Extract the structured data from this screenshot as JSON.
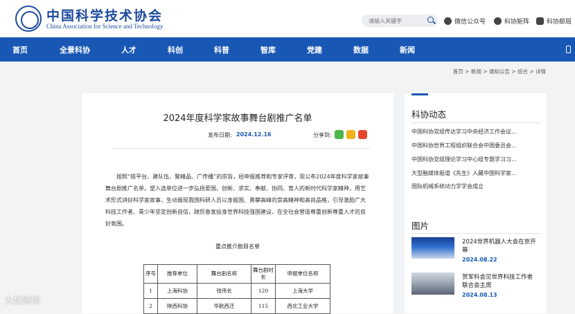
{
  "header": {
    "logo_cn": "中国科学技术协会",
    "logo_en": "China Association for Science and Technology",
    "search_placeholder": "请输入关键字",
    "links": [
      "微信公众号",
      "科协矩阵",
      "科协邮局"
    ]
  },
  "nav": {
    "items": [
      "首页",
      "全景科协",
      "人才",
      "科创",
      "科普",
      "智库",
      "党建",
      "数据",
      "新闻"
    ]
  },
  "breadcrumb": "首页 > 新闻 > 通知公告 > 综合 > 详情",
  "article": {
    "title": "2024年度科学家故事舞台剧推广名单",
    "date_label": "发布日期:",
    "date": "2024.12.16",
    "share_label": "分享到:",
    "body": "按照“搭平台、建队伍、聚精品、广传播”的宗旨，经申报推荐和专家评审，现公布2024年度科学家故事舞台剧推广名单。望入选单位进一步弘扬爱国、创新、求实、奉献、协同、育人的新时代科学家精神，用艺术形式讲好科学家故事，生动展现我国科研人员以身报国、勇攀高峰的崇高精神和高尚品格，引导激励广大科技工作者、青少年坚定创新自信，踔厉奋发投身世界科技强国建设，在全社会营造尊重创新尊重人才的良好氛围。",
    "subtitle": "重点推介剧目名单",
    "table": {
      "headers": [
        "序号",
        "推荐单位",
        "舞台剧名称",
        "舞台剧时长",
        "申报单位名称"
      ],
      "rows": [
        [
          "1",
          "上海科协",
          "钱伟长",
          "120",
          "上海大学"
        ],
        [
          "2",
          "陕西科协",
          "华航西迁",
          "115",
          "西北工业大学"
        ]
      ]
    }
  },
  "sidebar": {
    "news_heading": "科协动态",
    "news": [
      "中国科协党组传达学习中央经济工作会议…",
      "中国科协世界工程组织联合会中国委员会…",
      "中国科协党组理论学习中心组专题学习习…",
      "大型融媒体报道《先生》入藏中国科学家…",
      "国际机械系统动力学学会成立"
    ],
    "pics_heading": "图片",
    "pics": [
      {
        "caption": "2024世界机器人大会在京开幕",
        "date": "2024.08.22"
      },
      {
        "caption": "贺军科会见世界科技工作者联合会主席",
        "date": "2024.08.13"
      }
    ]
  },
  "watermark": "大数跨境"
}
